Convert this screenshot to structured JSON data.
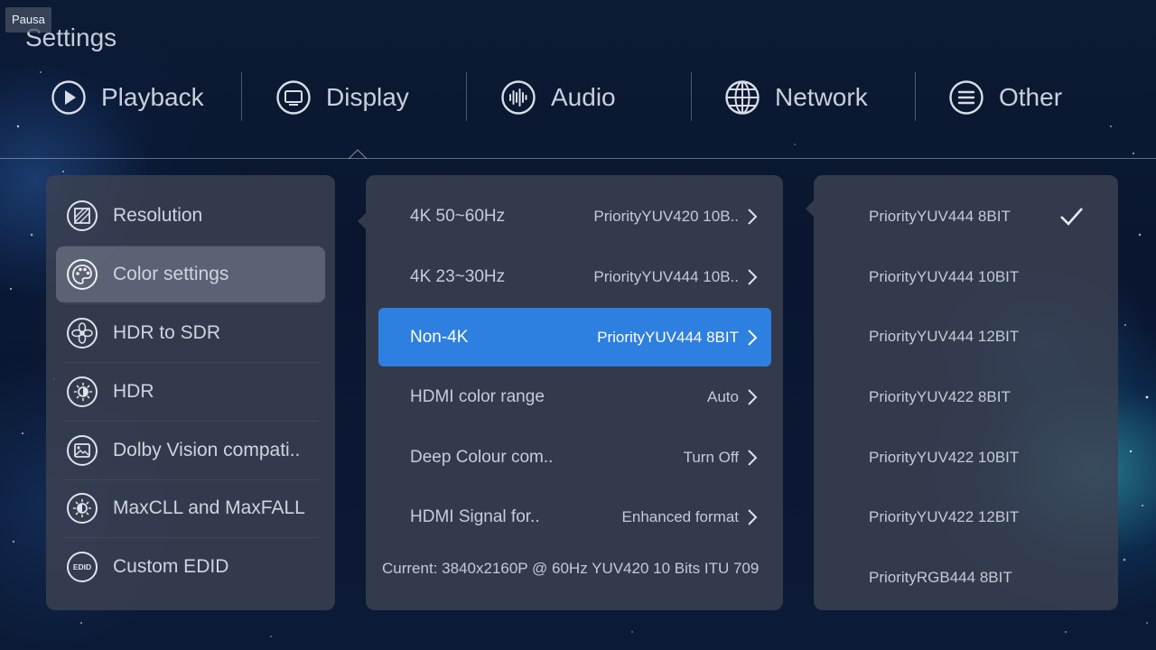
{
  "overlay": {
    "pause_label": "Pausa"
  },
  "page": {
    "title": "Settings"
  },
  "tabs": [
    {
      "label": "Playback",
      "icon": "play-circle-icon"
    },
    {
      "label": "Display",
      "icon": "monitor-icon"
    },
    {
      "label": "Audio",
      "icon": "waveform-icon"
    },
    {
      "label": "Network",
      "icon": "globe-icon"
    },
    {
      "label": "Other",
      "icon": "menu-lines-icon"
    }
  ],
  "selected_tab": "Display",
  "left_menu": {
    "items": [
      {
        "label": "Resolution",
        "icon": "resolution-icon"
      },
      {
        "label": "Color settings",
        "icon": "palette-icon"
      },
      {
        "label": "HDR to SDR",
        "icon": "aperture-icon"
      },
      {
        "label": "HDR",
        "icon": "brightness-icon"
      },
      {
        "label": "Dolby Vision compati..",
        "icon": "picture-icon"
      },
      {
        "label": "MaxCLL and MaxFALL",
        "icon": "sun-half-icon"
      },
      {
        "label": "Custom EDID",
        "icon": "edid-icon",
        "icon_text": "EDID"
      }
    ],
    "selected": "Color settings"
  },
  "color_settings": {
    "items": [
      {
        "label": "4K 50~60Hz",
        "value": "PriorityYUV420 10B.."
      },
      {
        "label": "4K 23~30Hz",
        "value": "PriorityYUV444 10B.."
      },
      {
        "label": "Non-4K",
        "value": "PriorityYUV444 8BIT"
      },
      {
        "label": "HDMI color range",
        "value": "Auto"
      },
      {
        "label": "Deep Colour com..",
        "value": "Turn Off"
      },
      {
        "label": "HDMI Signal for..",
        "value": "Enhanced format"
      }
    ],
    "active": "Non-4K",
    "current_info": "Current: 3840x2160P @ 60Hz  YUV420  10 Bits  ITU 709"
  },
  "format_options": {
    "items": [
      "PriorityYUV444 8BIT",
      "PriorityYUV444 10BIT",
      "PriorityYUV444 12BIT",
      "PriorityYUV422 8BIT",
      "PriorityYUV422 10BIT",
      "PriorityYUV422 12BIT",
      "PriorityRGB444 8BIT"
    ],
    "checked": "PriorityYUV444 8BIT"
  },
  "colors": {
    "accent": "#2d7fe0",
    "panel": "#3c4252",
    "background": "#0b1a36",
    "text": "#c6ccd8"
  }
}
